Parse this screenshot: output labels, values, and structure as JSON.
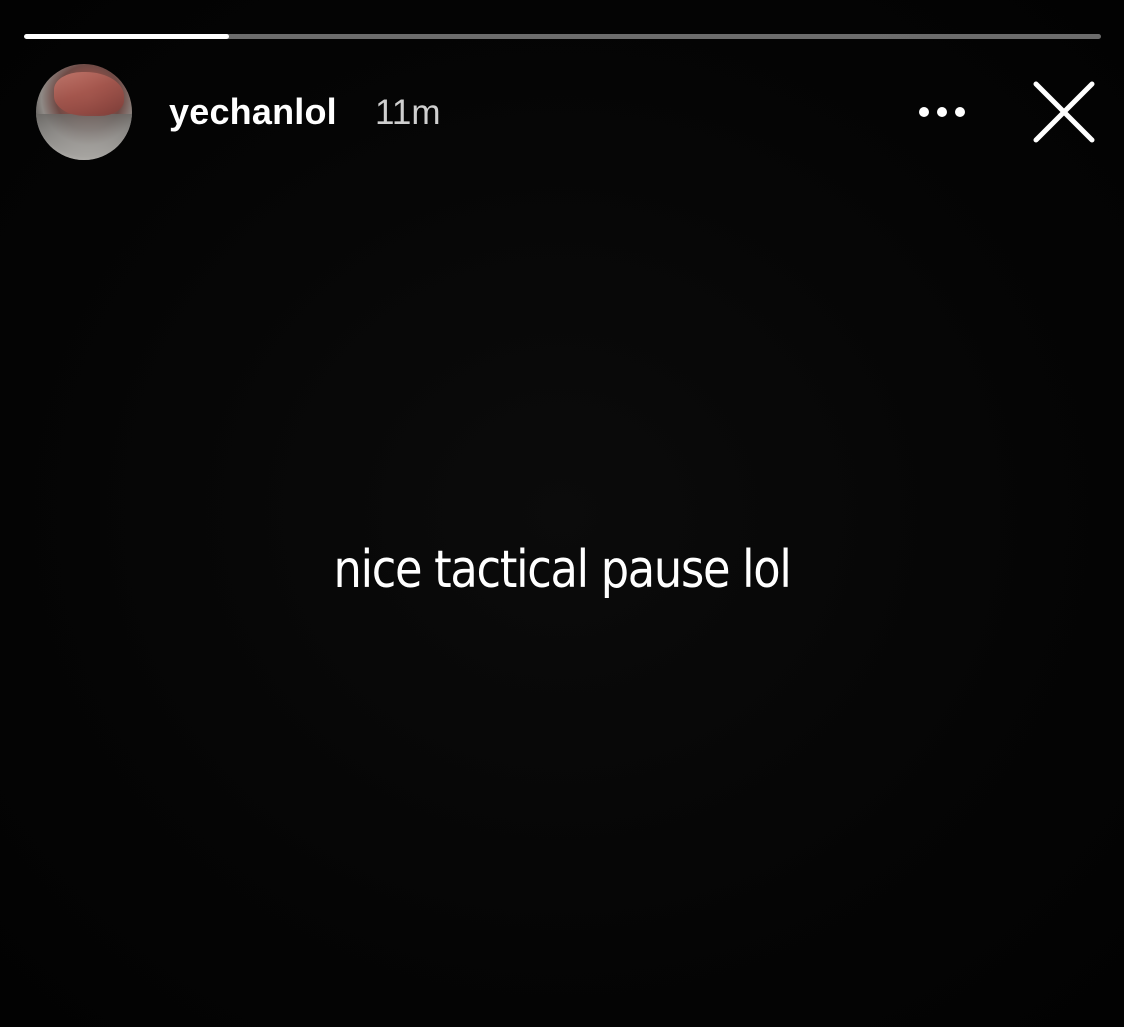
{
  "story": {
    "progress": 0.19,
    "username": "yechanlol",
    "timestamp": "11m",
    "text": "nice tactical pause lol"
  },
  "icons": {
    "more": "more-options-icon",
    "close": "close-icon",
    "avatar": "profile-avatar"
  },
  "colors": {
    "background": "#000000",
    "text": "#ffffff",
    "timestamp": "#cfcfcf",
    "progress_track": "rgba(255,255,255,0.42)",
    "progress_fill": "#ffffff"
  }
}
